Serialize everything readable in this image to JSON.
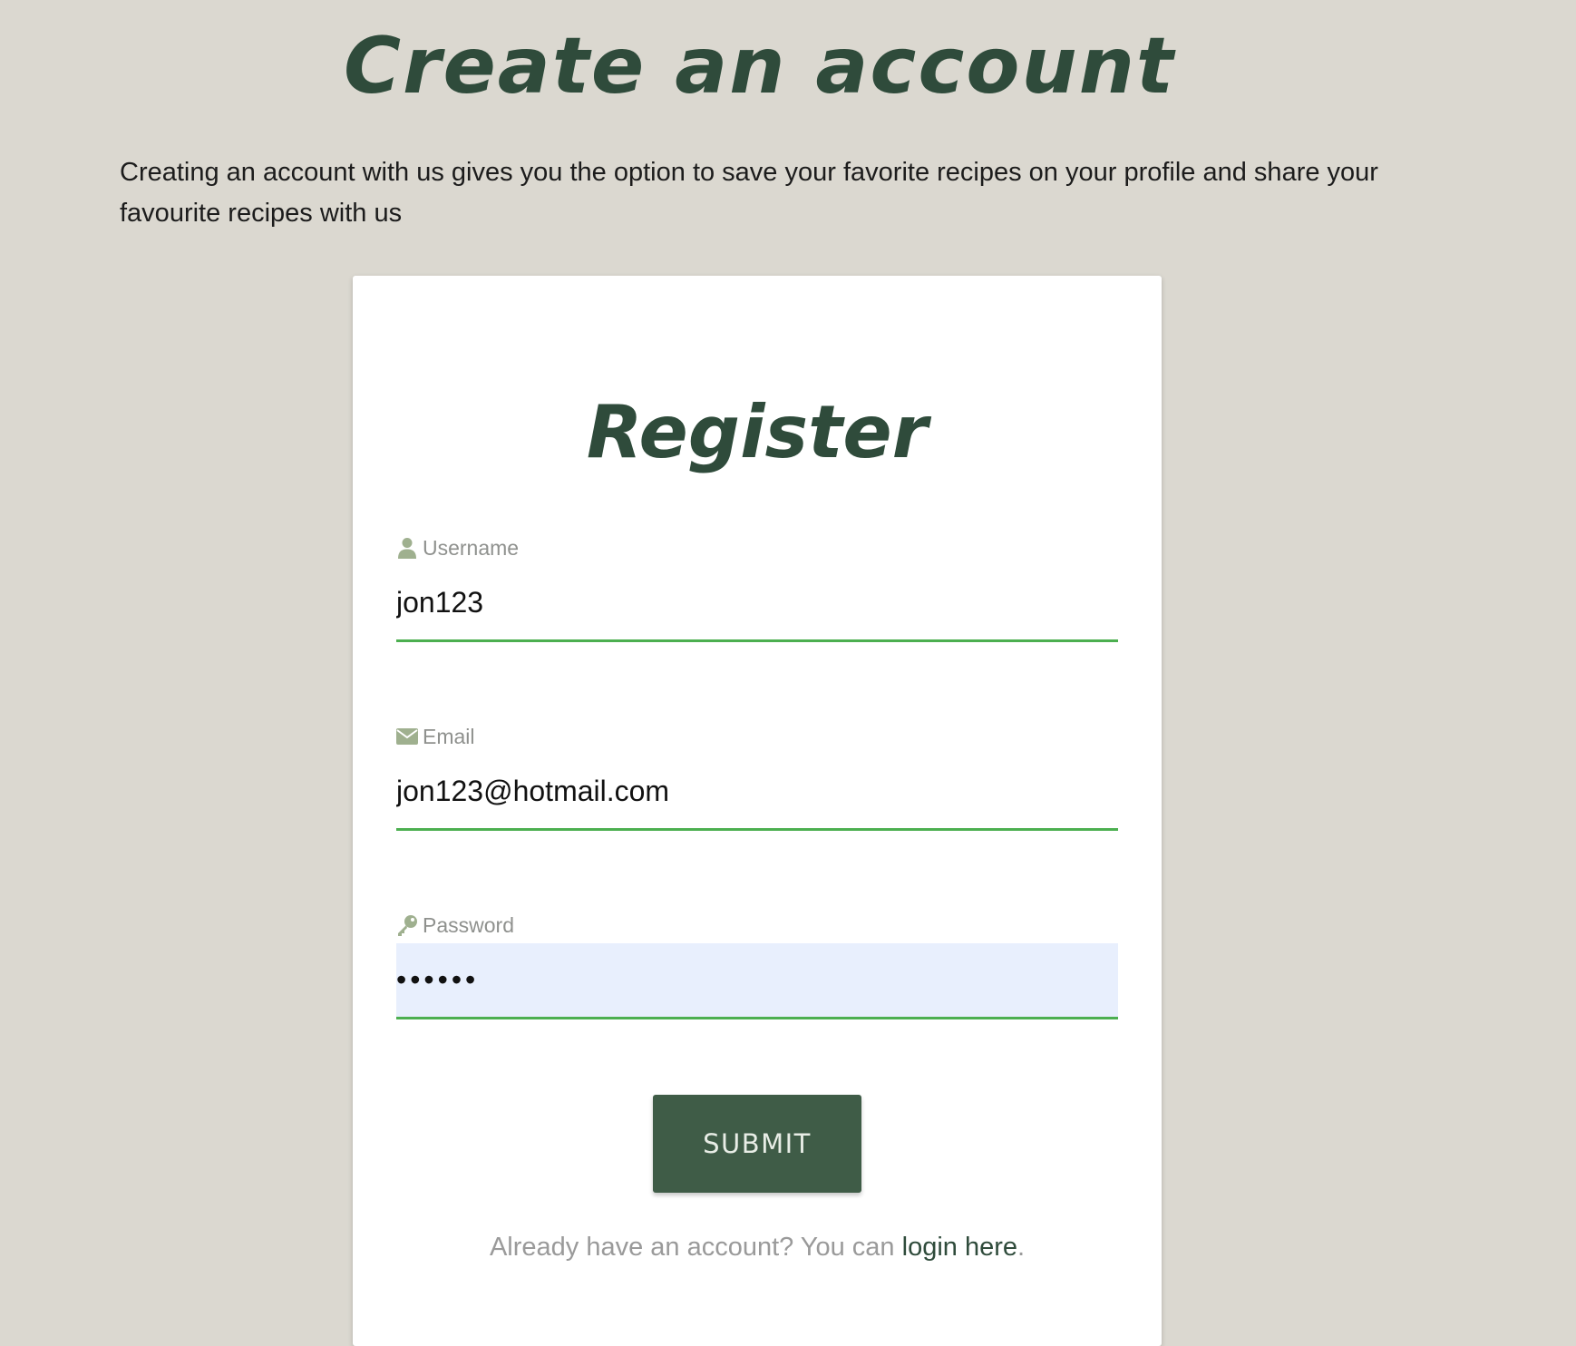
{
  "page": {
    "heading": "Create an account",
    "intro": "Creating an account with us gives you the option to save your favorite recipes on your profile and share your favourite recipes with us"
  },
  "form": {
    "title": "Register",
    "fields": [
      {
        "label": "Username",
        "icon": "user-icon",
        "value": "jon123",
        "type": "text"
      },
      {
        "label": "Email",
        "icon": "envelope-icon",
        "value": "jon123@hotmail.com",
        "type": "email"
      },
      {
        "label": "Password",
        "icon": "key-icon",
        "value": "••••••",
        "type": "password"
      }
    ],
    "submit_label": "SUBMIT",
    "login_prefix": "Already have an account? You can ",
    "login_link": "login here",
    "login_suffix": "."
  },
  "colors": {
    "background": "#dbd8d0",
    "heading": "#2f4b3b",
    "button": "#3f5c47",
    "underline": "#4caf50",
    "icon": "#9fb08f",
    "autofill": "#e8effd"
  }
}
